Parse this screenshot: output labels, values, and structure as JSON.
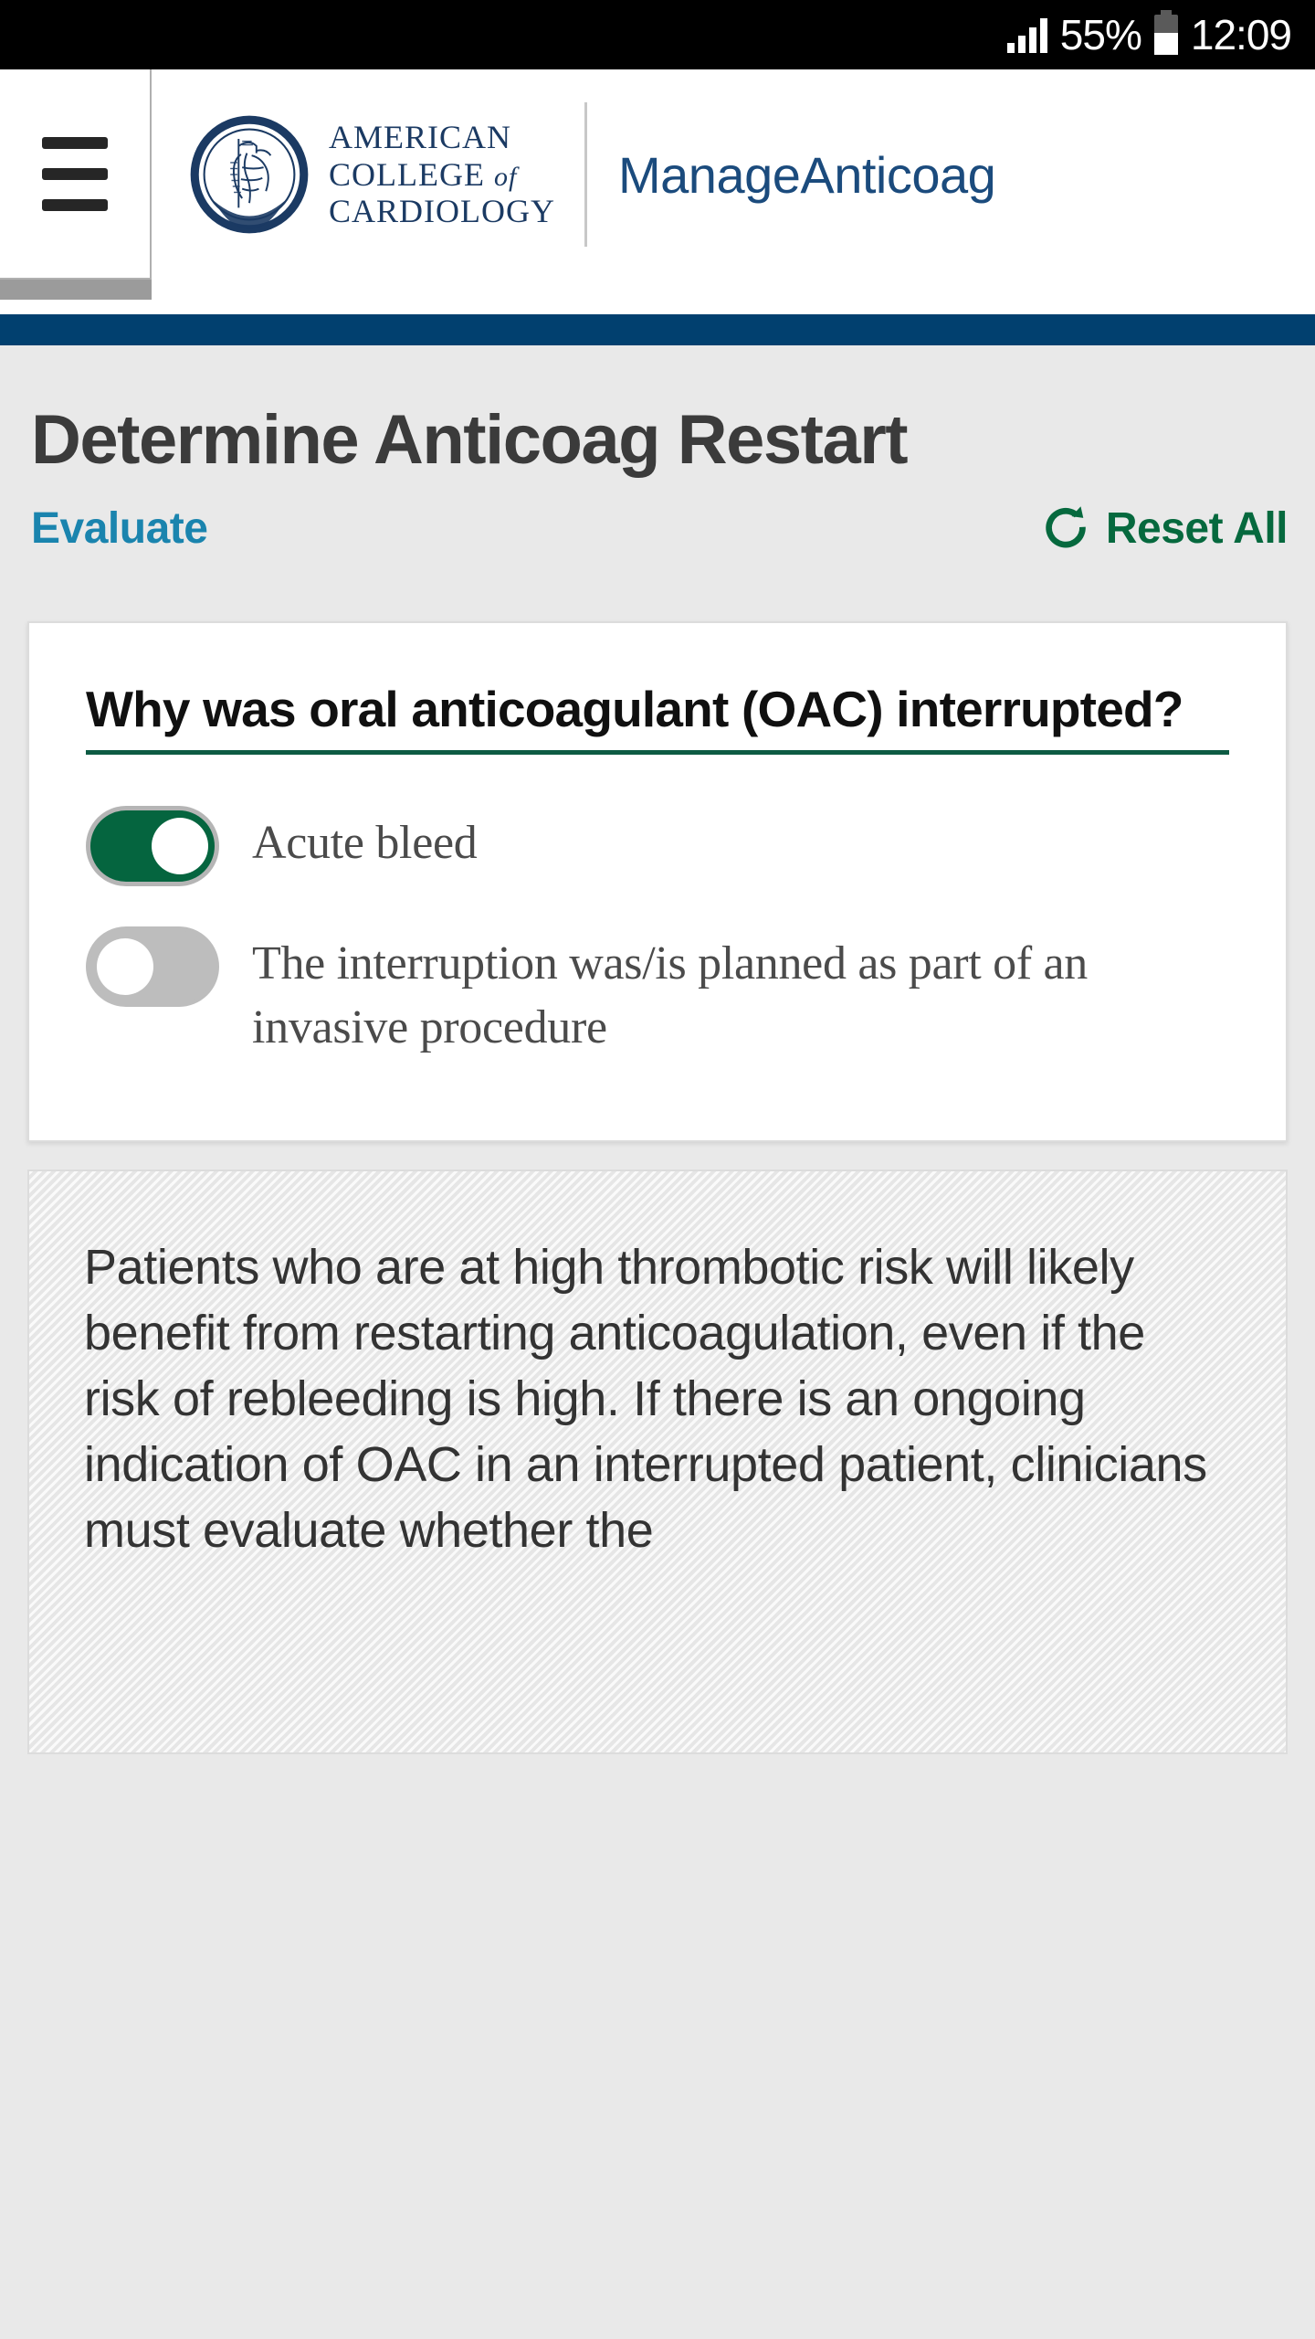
{
  "status_bar": {
    "signal_icon": "signal-bars-icon",
    "battery_percent": "55%",
    "battery_icon": "battery-icon",
    "time": "12:09"
  },
  "header": {
    "menu_icon": "hamburger-menu-icon",
    "logo_icon": "acc-seal-logo",
    "org_line1": "AMERICAN",
    "org_line2_main": "COLLEGE ",
    "org_line2_italic": "of",
    "org_line3": "CARDIOLOGY",
    "app_name": "ManageAnticoag"
  },
  "page": {
    "title": "Determine Anticoag Restart",
    "evaluate_label": "Evaluate",
    "reset_icon": "refresh-icon",
    "reset_label": "Reset All"
  },
  "question_card": {
    "question": "Why was oral anticoagulant (OAC) interrupted?",
    "options": [
      {
        "label": "Acute bleed",
        "state": "on"
      },
      {
        "label": "The interruption was/is planned as part of an invasive procedure",
        "state": "off"
      }
    ]
  },
  "info_panel": {
    "text": "Patients who are at high thrombotic risk will likely benefit from restarting anticoagulation, even if the risk of rebleeding is high. If there is an ongoing indication of OAC in an interrupted patient, clinicians must evaluate whether the"
  },
  "colors": {
    "navy_bar": "#01406f",
    "brand_blue": "#1b4b7d",
    "evaluate_teal": "#1a84ae",
    "reset_green": "#06693e",
    "toggle_on_green": "#05653f",
    "toggle_off_gray": "#bdbdbd",
    "question_underline": "#0d5b43",
    "page_background": "#e9e9e9"
  }
}
